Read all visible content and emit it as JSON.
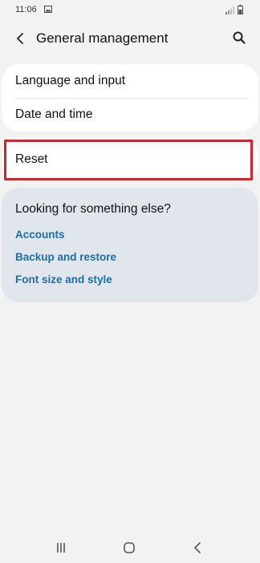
{
  "status_bar": {
    "time": "11:06",
    "icons": [
      "gallery-icon",
      "signal-icon",
      "battery-icon"
    ]
  },
  "header": {
    "title": "General management",
    "back_icon": "back-arrow-icon",
    "search_icon": "search-icon"
  },
  "settings": {
    "items": [
      {
        "label": "Language and input"
      },
      {
        "label": "Date and time"
      }
    ],
    "reset": {
      "label": "Reset"
    }
  },
  "suggestions": {
    "title": "Looking for something else?",
    "links": [
      {
        "label": "Accounts"
      },
      {
        "label": "Backup and restore"
      },
      {
        "label": "Font size and style"
      }
    ]
  },
  "navigation_bar": {
    "icons": [
      "recent-apps-icon",
      "home-icon",
      "back-icon"
    ]
  },
  "colors": {
    "background": "#f2f2f2",
    "card": "#ffffff",
    "suggestion_card": "#e1e6ec",
    "link": "#1a6fa8",
    "highlight": "#d9202b"
  }
}
